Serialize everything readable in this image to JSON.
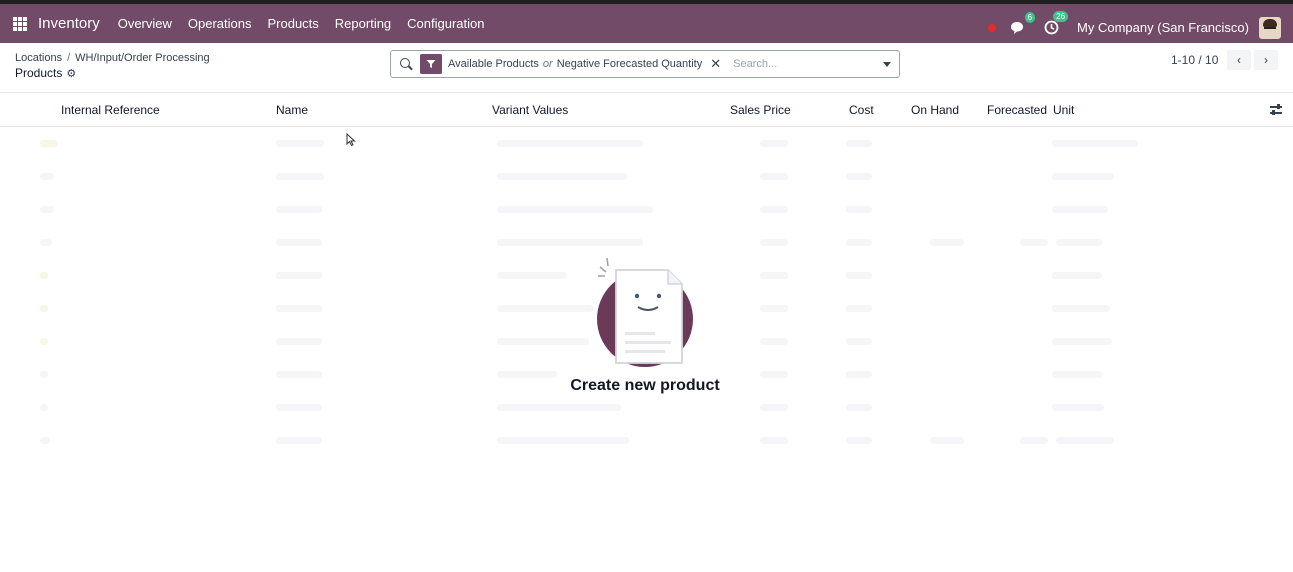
{
  "app": {
    "brand": "Inventory",
    "menu": [
      "Overview",
      "Operations",
      "Products",
      "Reporting",
      "Configuration"
    ],
    "icons": [
      "apps-grid-icon",
      "record-dot-icon",
      "chat-icon",
      "activity-clock-icon"
    ],
    "chat_count": "6",
    "activity_count": "26",
    "company": "My Company (San Francisco)",
    "accent_color": "#714b67"
  },
  "breadcrumb": {
    "parent": "Locations",
    "separator": "/",
    "current": "WH/Input/Order Processing"
  },
  "page": {
    "title": "Products"
  },
  "search": {
    "facet_values": [
      "Available Products",
      "Negative Forecasted Quantity"
    ],
    "facet_or": "or",
    "placeholder": "Search..."
  },
  "pager": {
    "value": "1-10 / 10"
  },
  "table": {
    "columns": [
      "Internal Reference",
      "Name",
      "Variant Values",
      "Sales Price",
      "Cost",
      "On Hand",
      "Forecasted",
      "Unit"
    ]
  },
  "empty_state": {
    "title": "Create new product"
  }
}
